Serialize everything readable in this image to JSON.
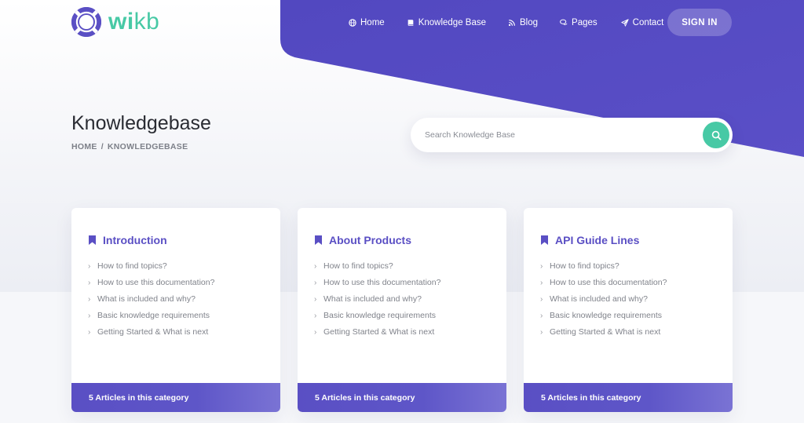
{
  "brand": {
    "name_part1": "wi",
    "name_part2": "kb",
    "accent": "#47c9a5",
    "primary": "#5a4fc4"
  },
  "nav": {
    "items": [
      {
        "label": "Home",
        "icon": "globe-icon"
      },
      {
        "label": "Knowledge Base",
        "icon": "book-icon"
      },
      {
        "label": "Blog",
        "icon": "rss-icon"
      },
      {
        "label": "Pages",
        "icon": "comments-icon"
      },
      {
        "label": "Contact",
        "icon": "paper-plane-icon"
      }
    ],
    "signin_label": "SIGN IN"
  },
  "page": {
    "title": "Knowledgebase",
    "breadcrumb": [
      "HOME",
      "/",
      "KNOWLEDGEBASE"
    ]
  },
  "search": {
    "placeholder": "Search Knowledge Base",
    "icon": "search-icon"
  },
  "cards": [
    {
      "title": "Introduction",
      "items": [
        "How to find topics?",
        "How to use this documentation?",
        "What is included and why?",
        "Basic knowledge requirements",
        "Getting Started & What is next"
      ],
      "footer": "5 Articles in this category"
    },
    {
      "title": "About Products",
      "items": [
        "How to find topics?",
        "How to use this documentation?",
        "What is included and why?",
        "Basic knowledge requirements",
        "Getting Started & What is next"
      ],
      "footer": "5 Articles in this category"
    },
    {
      "title": "API Guide Lines",
      "items": [
        "How to find topics?",
        "How to use this documentation?",
        "What is included and why?",
        "Basic knowledge requirements",
        "Getting Started & What is next"
      ],
      "footer": "5 Articles in this category"
    }
  ]
}
